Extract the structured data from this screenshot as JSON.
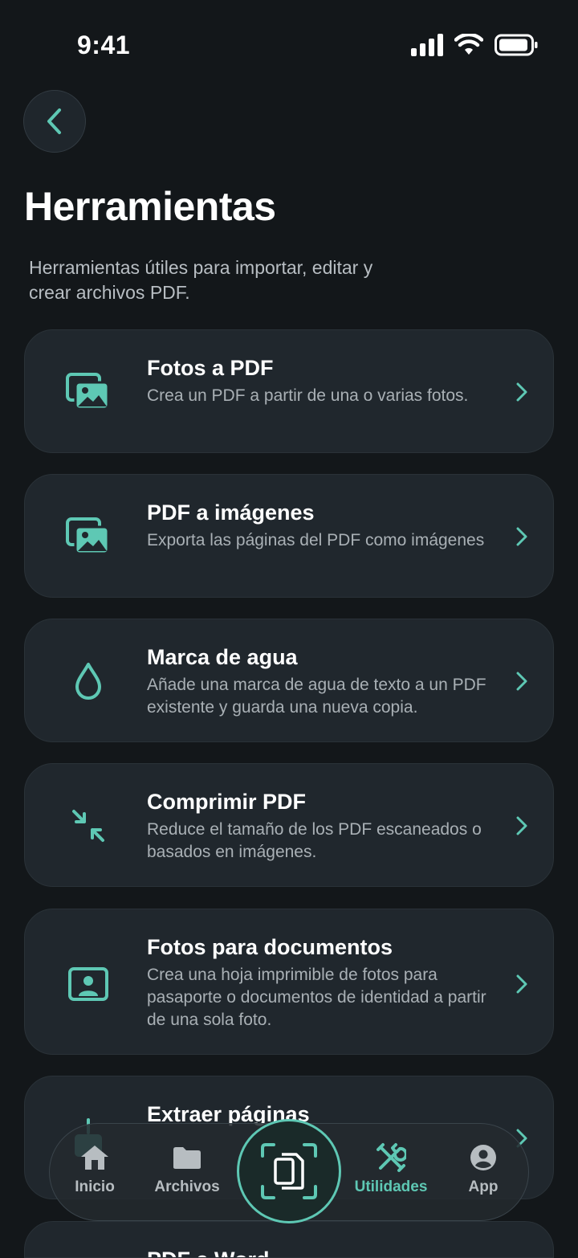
{
  "status_bar": {
    "time": "9:41"
  },
  "header": {
    "title": "Herramientas",
    "subtitle": "Herramientas útiles para importar, editar y crear archivos PDF."
  },
  "tools": [
    {
      "title": "Fotos a PDF",
      "description": "Crea un PDF a partir de una o varias fotos.",
      "icon": "photos-icon"
    },
    {
      "title": "PDF a imágenes",
      "description": "Exporta las páginas del PDF como imágenes",
      "icon": "images-icon"
    },
    {
      "title": "Marca de agua",
      "description": "Añade una marca de agua de texto a un PDF existente y guarda una nueva copia.",
      "icon": "water-drop-icon"
    },
    {
      "title": "Comprimir PDF",
      "description": "Reduce el tamaño de los PDF escaneados o basados en imágenes.",
      "icon": "compress-icon"
    },
    {
      "title": "Fotos para documentos",
      "description": "Crea una hoja imprimible de fotos para pasaporte o documentos de identidad a partir de una sola foto.",
      "icon": "id-photo-icon"
    },
    {
      "title": "Extraer páginas",
      "description": "",
      "icon": "extract-pages-icon"
    },
    {
      "title": "PDF a Word",
      "description": "",
      "icon": "word-icon"
    }
  ],
  "tab_bar": {
    "items": [
      {
        "label": "Inicio",
        "icon": "home-icon"
      },
      {
        "label": "Archivos",
        "icon": "folder-icon"
      },
      {
        "label": "Utilidades",
        "icon": "tools-icon"
      },
      {
        "label": "App",
        "icon": "user-icon"
      }
    ],
    "active": "Utilidades"
  },
  "colors": {
    "accent": "#5ec8b4",
    "background": "#13171a",
    "card": "#20272d"
  }
}
